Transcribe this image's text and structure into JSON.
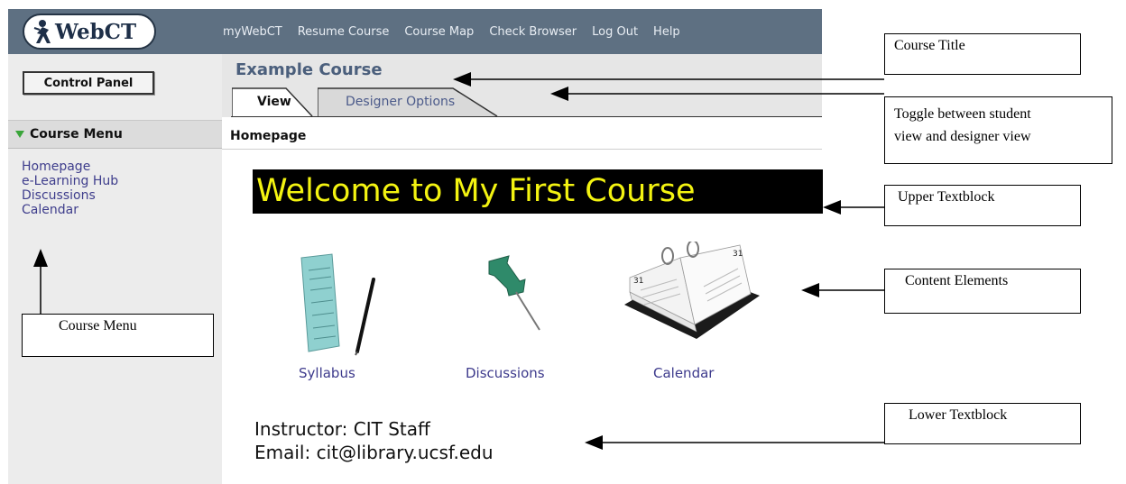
{
  "app": {
    "logo_text": "WebCT",
    "nav": [
      "myWebCT",
      "Resume Course",
      "Course Map",
      "Check Browser",
      "Log Out",
      "Help"
    ],
    "control_panel_label": "Control Panel",
    "course_menu": {
      "title": "Course Menu",
      "items": [
        "Homepage",
        "e-Learning Hub",
        "Discussions",
        "Calendar"
      ]
    },
    "course_title": "Example Course",
    "tabs": [
      {
        "label": "View",
        "active": true
      },
      {
        "label": "Designer Options",
        "active": false
      }
    ],
    "page_label": "Homepage",
    "upper_textblock": "Welcome to My First Course",
    "content_elements": [
      {
        "label": "Syllabus",
        "icon": "syllabus-icon"
      },
      {
        "label": "Discussions",
        "icon": "pushpin-icon"
      },
      {
        "label": "Calendar",
        "icon": "desk-calendar-icon"
      }
    ],
    "lower_textblock": {
      "line1": "Instructor: CIT Staff",
      "line2": "Email: cit@library.ucsf.edu"
    }
  },
  "annotations": {
    "course_title": "Course Title",
    "toggle": "Toggle between student view and designer view",
    "toggle_line1": "Toggle between student",
    "toggle_line2": "view and designer view",
    "upper_textblock": "Upper Textblock",
    "content_elements": "Content Elements",
    "lower_textblock": "Lower Textblock",
    "course_menu": "Course Menu"
  },
  "colors": {
    "topbar": "#5e7082",
    "welcome_bg": "#000000",
    "welcome_text": "#f3f311",
    "link": "#3e3d8c",
    "menu_arrow": "#3aa53a"
  }
}
